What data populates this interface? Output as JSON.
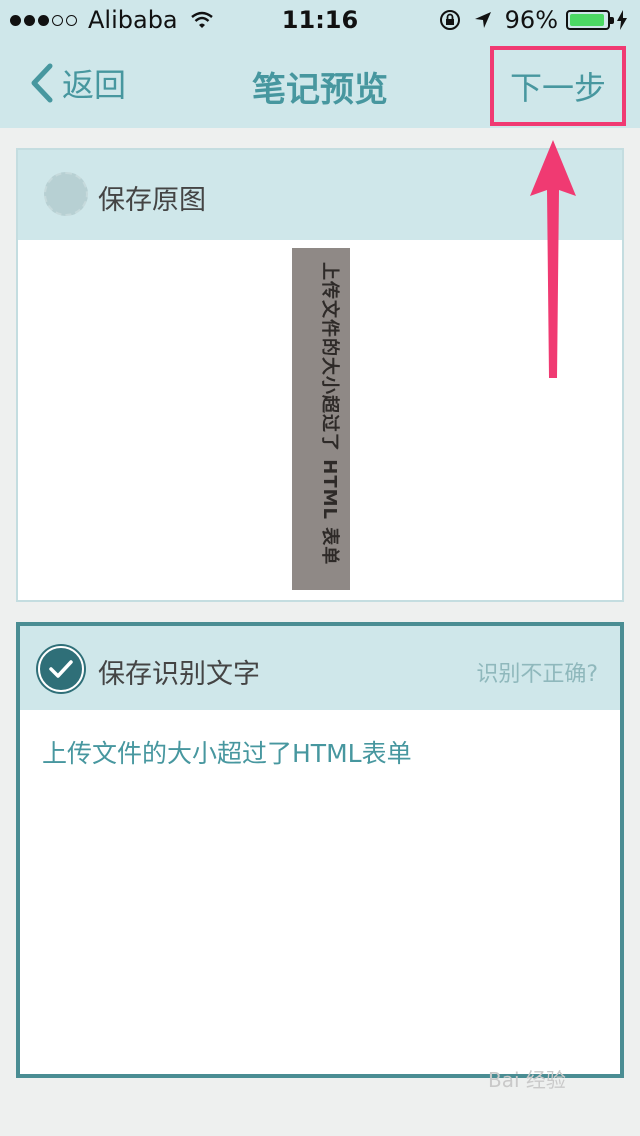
{
  "status_bar": {
    "carrier": "Alibaba",
    "time": "11:16",
    "battery": "96%"
  },
  "nav": {
    "back_label": "返回",
    "title": "笔记预览",
    "next_label": "下一步"
  },
  "card_original": {
    "label": "保存原图",
    "image_text": "上传文件的大小超过了 HTML 表单"
  },
  "card_text": {
    "label": "保存识别文字",
    "wrong_link": "识别不正确?",
    "recognized_text": "上传文件的大小超过了HTML表单"
  },
  "watermark": "Bai 经验"
}
